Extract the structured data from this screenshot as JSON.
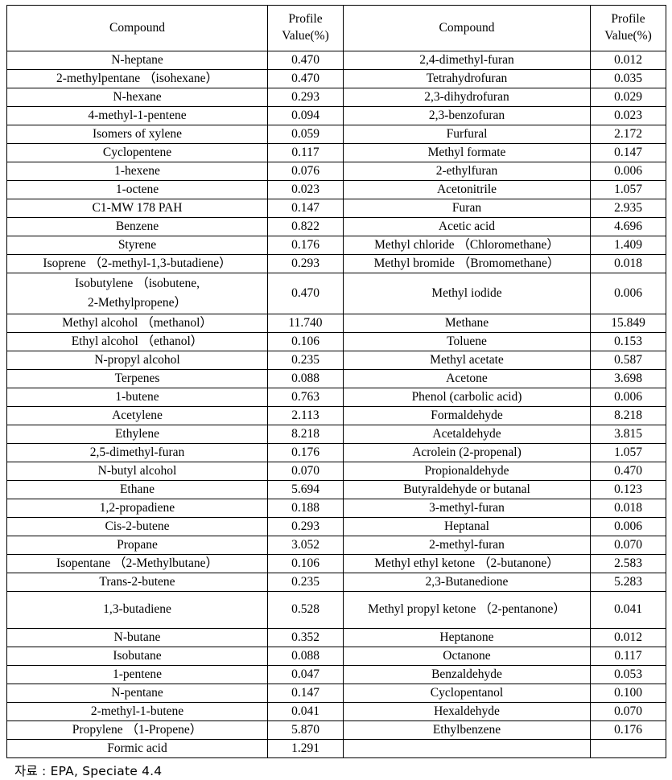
{
  "table": {
    "headers": {
      "compound": "Compound",
      "profile_line1": "Profile",
      "profile_line2": "Value(%)"
    },
    "left_rows": [
      {
        "compound": "N-heptane",
        "value": "0.470"
      },
      {
        "compound": "2-methylpentane （isohexane）",
        "value": "0.470"
      },
      {
        "compound": "N-hexane",
        "value": "0.293"
      },
      {
        "compound": "4-methyl-1-pentene",
        "value": "0.094"
      },
      {
        "compound": "Isomers of  xylene",
        "value": "0.059"
      },
      {
        "compound": "Cyclopentene",
        "value": "0.117"
      },
      {
        "compound": "1-hexene",
        "value": "0.076"
      },
      {
        "compound": "1-octene",
        "value": "0.023"
      },
      {
        "compound": "C1-MW 178 PAH",
        "value": "0.147"
      },
      {
        "compound": "Benzene",
        "value": "0.822"
      },
      {
        "compound": "Styrene",
        "value": "0.176"
      },
      {
        "compound": "Isoprene （2-methyl-1,3-butadiene）",
        "value": "0.293"
      },
      {
        "compound": "Isobutylene （isobutene,",
        "compound_line2": "2-Methylpropene）",
        "value": "0.470",
        "tall": true
      },
      {
        "compound": "Methyl alcohol （methanol）",
        "value": "11.740"
      },
      {
        "compound": "Ethyl alcohol （ethanol）",
        "value": "0.106"
      },
      {
        "compound": "N-propyl  alcohol",
        "value": "0.235"
      },
      {
        "compound": "Terpenes",
        "value": "0.088"
      },
      {
        "compound": "1-butene",
        "value": "0.763"
      },
      {
        "compound": "Acetylene",
        "value": "2.113"
      },
      {
        "compound": "Ethylene",
        "value": "8.218"
      },
      {
        "compound": "2,5-dimethyl-furan",
        "value": "0.176"
      },
      {
        "compound": "N-butyl  alcohol",
        "value": "0.070"
      },
      {
        "compound": "Ethane",
        "value": "5.694"
      },
      {
        "compound": "1,2-propadiene",
        "value": "0.188"
      },
      {
        "compound": "Cis-2-butene",
        "value": "0.293"
      },
      {
        "compound": "Propane",
        "value": "3.052"
      },
      {
        "compound": "Isopentane （2-Methylbutane）",
        "value": "0.106"
      },
      {
        "compound": "Trans-2-butene",
        "value": "0.235"
      },
      {
        "compound": "1,3-butadiene",
        "value": "0.528",
        "tall": true
      },
      {
        "compound": "N-butane",
        "value": "0.352"
      },
      {
        "compound": "Isobutane",
        "value": "0.088"
      },
      {
        "compound": "1-pentene",
        "value": "0.047"
      },
      {
        "compound": "N-pentane",
        "value": "0.147"
      },
      {
        "compound": "2-methyl-1-butene",
        "value": "0.041"
      },
      {
        "compound": "Propylene （1-Propene）",
        "value": "5.870"
      },
      {
        "compound": "Formic acid",
        "value": "1.291"
      }
    ],
    "right_rows": [
      {
        "compound": "2,4-dimethyl-furan",
        "value": "0.012"
      },
      {
        "compound": "Tetrahydrofuran",
        "value": "0.035"
      },
      {
        "compound": "2,3-dihydrofuran",
        "value": "0.029"
      },
      {
        "compound": "2,3-benzofuran",
        "value": "0.023"
      },
      {
        "compound": "Furfural",
        "value": "2.172"
      },
      {
        "compound": "Methyl formate",
        "value": "0.147"
      },
      {
        "compound": "2-ethylfuran",
        "value": "0.006"
      },
      {
        "compound": "Acetonitrile",
        "value": "1.057"
      },
      {
        "compound": "Furan",
        "value": "2.935"
      },
      {
        "compound": "Acetic acid",
        "value": "4.696"
      },
      {
        "compound": "Methyl chloride （Chloromethane）",
        "value": "1.409"
      },
      {
        "compound": "Methyl bromide （Bromomethane）",
        "value": "0.018"
      },
      {
        "compound": "Methyl iodide",
        "value": "0.006",
        "tall": true
      },
      {
        "compound": "Methane",
        "value": "15.849"
      },
      {
        "compound": "Toluene",
        "value": "0.153"
      },
      {
        "compound": "Methyl acetate",
        "value": "0.587"
      },
      {
        "compound": "Acetone",
        "value": "3.698"
      },
      {
        "compound": "Phenol (carbolic  acid)",
        "value": "0.006"
      },
      {
        "compound": "Formaldehyde",
        "value": "8.218"
      },
      {
        "compound": "Acetaldehyde",
        "value": "3.815"
      },
      {
        "compound": "Acrolein (2-propenal)",
        "value": "1.057"
      },
      {
        "compound": "Propionaldehyde",
        "value": "0.470"
      },
      {
        "compound": "Butyraldehyde or  butanal",
        "value": "0.123"
      },
      {
        "compound": "3-methyl-furan",
        "value": "0.018"
      },
      {
        "compound": "Heptanal",
        "value": "0.006"
      },
      {
        "compound": "2-methyl-furan",
        "value": "0.070"
      },
      {
        "compound": "Methyl ethyl ketone （2-butanone）",
        "value": "2.583"
      },
      {
        "compound": "2,3-Butanedione",
        "value": "5.283"
      },
      {
        "compound": "Methyl propyl ketone （2-pentanone）",
        "value": "0.041",
        "tall": true
      },
      {
        "compound": "Heptanone",
        "value": "0.012"
      },
      {
        "compound": "Octanone",
        "value": "0.117"
      },
      {
        "compound": "Benzaldehyde",
        "value": "0.053"
      },
      {
        "compound": "Cyclopentanol",
        "value": "0.100"
      },
      {
        "compound": "Hexaldehyde",
        "value": "0.070"
      },
      {
        "compound": "Ethylbenzene",
        "value": "0.176"
      },
      {
        "compound": "",
        "value": ""
      }
    ]
  },
  "source_note": "자료 : EPA,  Speciate 4.4"
}
